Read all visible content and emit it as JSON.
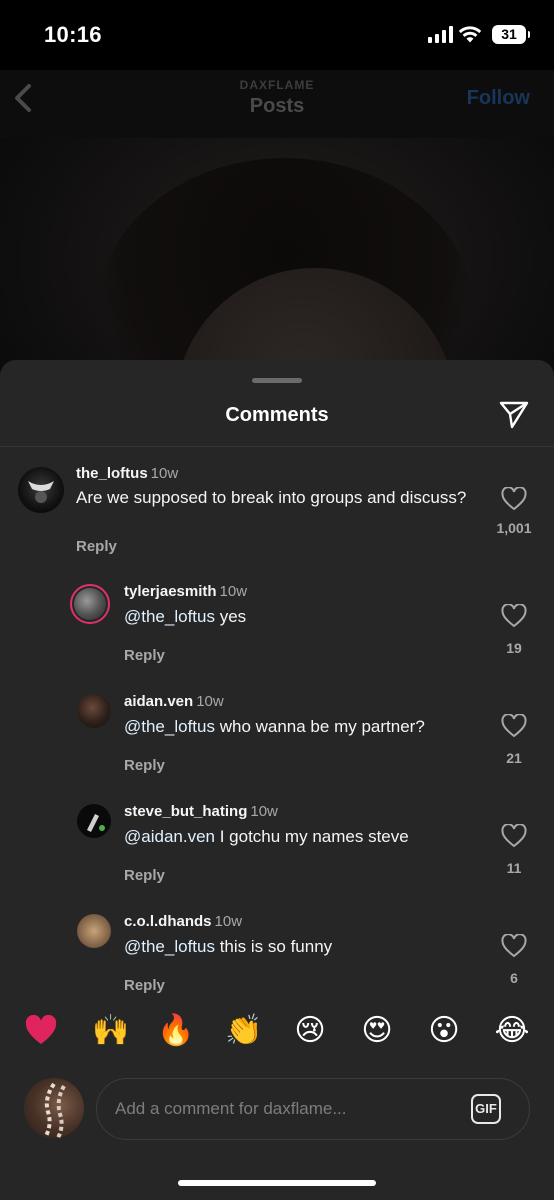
{
  "status_bar": {
    "time": "10:16",
    "battery": "31"
  },
  "header": {
    "subtitle": "DAXFLAME",
    "title": "Posts",
    "follow_label": "Follow"
  },
  "sheet": {
    "title": "Comments"
  },
  "comments": [
    {
      "username": "the_loftus",
      "time": "10w",
      "mention": "",
      "text": "Are we supposed to break into groups and discuss?",
      "reply_label": "Reply",
      "likes": "1,001"
    },
    {
      "username": "tylerjaesmith",
      "time": "10w",
      "mention": "@the_loftus",
      "text": " yes",
      "reply_label": "Reply",
      "likes": "19"
    },
    {
      "username": "aidan.ven",
      "time": "10w",
      "mention": "@the_loftus",
      "text": " who wanna be my partner?",
      "reply_label": "Reply",
      "likes": "21"
    },
    {
      "username": "steve_but_hating",
      "time": "10w",
      "mention": "@aidan.ven",
      "text": " I gotchu my names steve",
      "reply_label": "Reply",
      "likes": "11"
    },
    {
      "username": "c.o.l.dhands",
      "time": "10w",
      "mention": "@the_loftus",
      "text": " this is so funny",
      "reply_label": "Reply",
      "likes": "6"
    }
  ],
  "emoji_bar": [
    "❤️",
    "🙌",
    "🔥",
    "👏",
    "😢",
    "😍",
    "😮",
    "😂"
  ],
  "composer": {
    "placeholder": "Add a comment for daxflame...",
    "gif_label": "GIF"
  },
  "colors": {
    "background": "#000000",
    "sheet": "#262626",
    "text_secondary": "#a8a8a8",
    "mention": "#e0f1ff",
    "follow": "#17365a"
  }
}
